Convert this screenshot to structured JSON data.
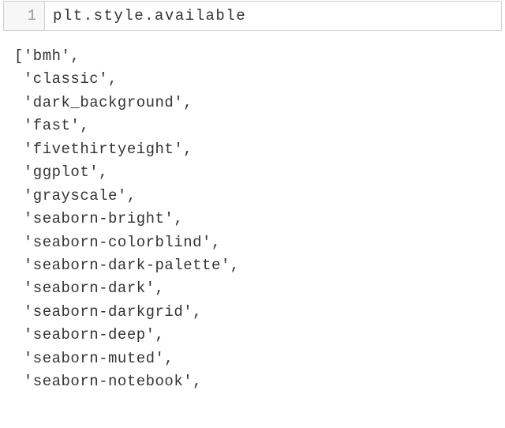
{
  "cell": {
    "line_number": "1",
    "code": "plt.style.available"
  },
  "output": {
    "open_bracket": "[",
    "quote": "'",
    "comma": ",",
    "items": [
      "bmh",
      "classic",
      "dark_background",
      "fast",
      "fivethirtyeight",
      "ggplot",
      "grayscale",
      "seaborn-bright",
      "seaborn-colorblind",
      "seaborn-dark-palette",
      "seaborn-dark",
      "seaborn-darkgrid",
      "seaborn-deep",
      "seaborn-muted",
      "seaborn-notebook"
    ]
  }
}
